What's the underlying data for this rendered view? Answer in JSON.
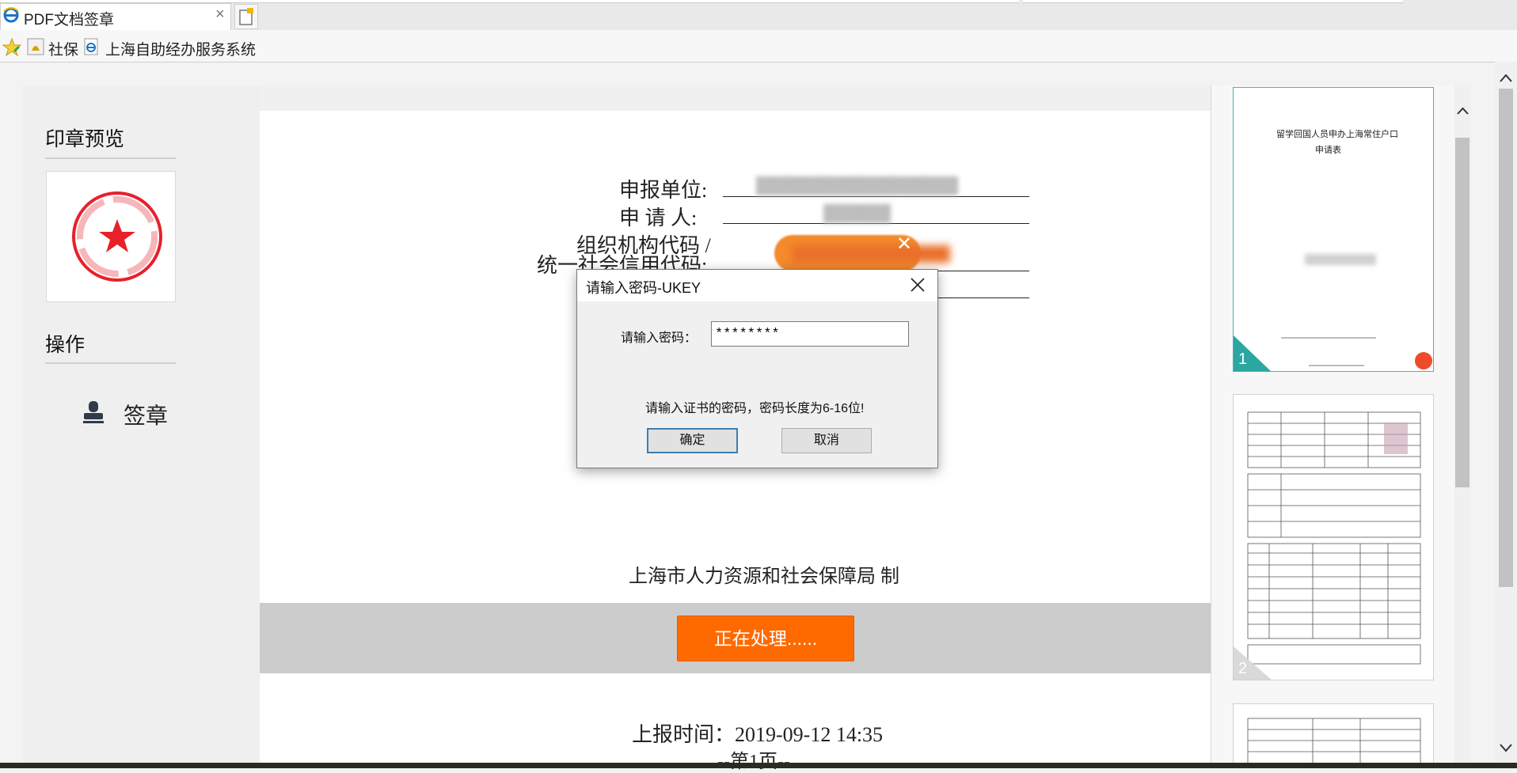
{
  "browser": {
    "tab_title": "PDF文档签章",
    "tab_close": "×",
    "favorites": [
      {
        "label": "社保",
        "icon": "shebao-icon"
      },
      {
        "label": "上海自助经办服务系统",
        "icon": "ie-page-icon"
      }
    ]
  },
  "sidebar": {
    "preview_heading": "印章预览",
    "operations_heading": "操作",
    "sign_label": "签章"
  },
  "document": {
    "fields": [
      {
        "label": "申报单位:"
      },
      {
        "label": "申 请 人:"
      },
      {
        "label": "组织机构代码 /"
      },
      {
        "label": "统一社会信用代码:"
      }
    ],
    "issuer": "上海市人力资源和社会保障局 制",
    "processing_button": "正在处理......",
    "report_time": "上报时间：2019-09-12 14:35",
    "page_label": "--第1页--"
  },
  "dialog": {
    "title": "请输入密码-UKEY",
    "password_label": "请输入密码：",
    "password_value": "********",
    "hint": "请输入证书的密码，密码长度为6-16位!",
    "ok_label": "确定",
    "cancel_label": "取消"
  },
  "thumbnails": [
    {
      "number": "1",
      "title_line1": "留学回国人员申办上海常住户口",
      "title_line2": "申请表",
      "selected": true
    },
    {
      "number": "2",
      "selected": false
    },
    {
      "number": "",
      "selected": false
    }
  ],
  "colors": {
    "accent_orange": "#ff6a00",
    "thumb_selected": "#2aa7a0",
    "seal_red": "#e8202a"
  }
}
